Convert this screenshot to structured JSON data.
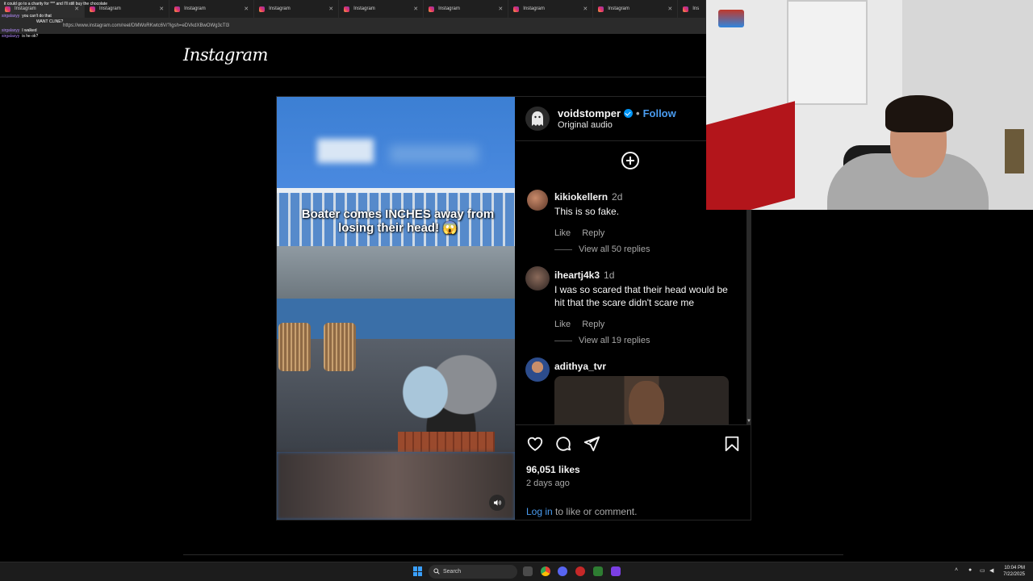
{
  "browser": {
    "tabs": [
      {
        "label": "Instagram",
        "active": true
      },
      {
        "label": "Instagram"
      },
      {
        "label": "Instagram"
      },
      {
        "label": "Instagram"
      },
      {
        "label": "Instagram"
      },
      {
        "label": "Instagram"
      },
      {
        "label": "Instagram"
      },
      {
        "label": "Instagram"
      },
      {
        "label": "Ins"
      }
    ],
    "url": "https://www.instagram.com/reel/DMWoRKwtc6V/?igsh=eDVkdXBwOWg3cTl3"
  },
  "chat": [
    {
      "user": "",
      "text": "it could go to a charity for *** and I'll still buy the chocolate"
    },
    {
      "user": "sirgalaxyy",
      "text": "you can't do that"
    },
    {
      "user": "",
      "text": "WANT CLINE?"
    },
    {
      "user": "sirgalaxyy",
      "text": "I walked"
    },
    {
      "user": "sirgalaxyy",
      "text": "is he ok?"
    }
  ],
  "header": {
    "logo": "Instagram"
  },
  "post": {
    "caption": "Boater comes INCHES away from losing their head! 😱",
    "author": "voidstomper",
    "verified": true,
    "follow_label": "Follow",
    "audio": "Original audio",
    "comments": [
      {
        "user": "kikiokellern",
        "time": "2d",
        "text": "This is so fake.",
        "like": "Like",
        "reply": "Reply",
        "view_replies": "View all 50 replies"
      },
      {
        "user": "iheartj4k3",
        "time": "1d",
        "text": "I was so scared that their head would be hit that the scare didn't scare me",
        "like": "Like",
        "reply": "Reply",
        "view_replies": "View all 19 replies"
      },
      {
        "user": "adithya_tvr",
        "time": "",
        "text": ""
      }
    ],
    "likes": "96,051 likes",
    "time_ago": "2 days ago",
    "login_link": "Log in",
    "login_text": " to like or comment."
  },
  "taskbar": {
    "search_label": "Search",
    "time": "10:04 PM",
    "date": "7/22/2025"
  },
  "colors": {
    "background": "#000000",
    "link_blue": "#4a9cf0",
    "verified_blue": "#0095f6",
    "muted_text": "#a8a8a8"
  }
}
